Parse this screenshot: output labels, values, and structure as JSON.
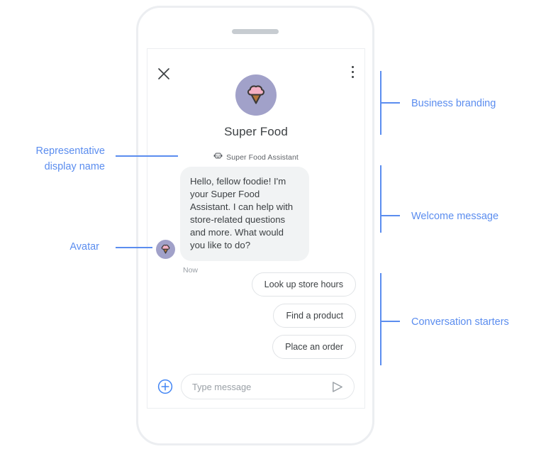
{
  "phone": {
    "speaker_name": "phone-speaker"
  },
  "chat": {
    "close_label": "close",
    "menu_label": "more options",
    "business_name": "Super Food",
    "representative_name": "Super Food Assistant",
    "welcome_message": "Hello, fellow foodie! I'm your Super Food Assistant. I can help with store-related questions and more. What would you like to do?",
    "timestamp": "Now",
    "conversation_starters": [
      "Look up store hours",
      "Find a product",
      "Place an order"
    ],
    "composer": {
      "placeholder": "Type message",
      "value": "",
      "add_icon": "plus-circle-icon",
      "send_icon": "send-icon"
    },
    "icons": {
      "close": "close-icon",
      "menu": "overflow-menu-icon",
      "logo": "ice-cream-logo-icon",
      "avatar": "ice-cream-avatar-icon",
      "representative": "bot-face-icon"
    }
  },
  "annotations": {
    "right": [
      {
        "label": "Business branding"
      },
      {
        "label": "Welcome message"
      },
      {
        "label": "Conversation starters"
      }
    ],
    "left": [
      {
        "label_line1": "Representative",
        "label_line2": "display name"
      },
      {
        "label_line1": "Avatar",
        "label_line2": ""
      }
    ]
  },
  "colors": {
    "annotation_blue": "#5b8def",
    "logo_circle": "#a1a1c9",
    "scoop_pink": "#f4b0c4",
    "cone_brown": "#b5763a",
    "bubble_gray": "#f1f3f4",
    "text_primary": "#3c4043",
    "text_secondary": "#5f6368",
    "frame_gray": "#eceef1"
  }
}
